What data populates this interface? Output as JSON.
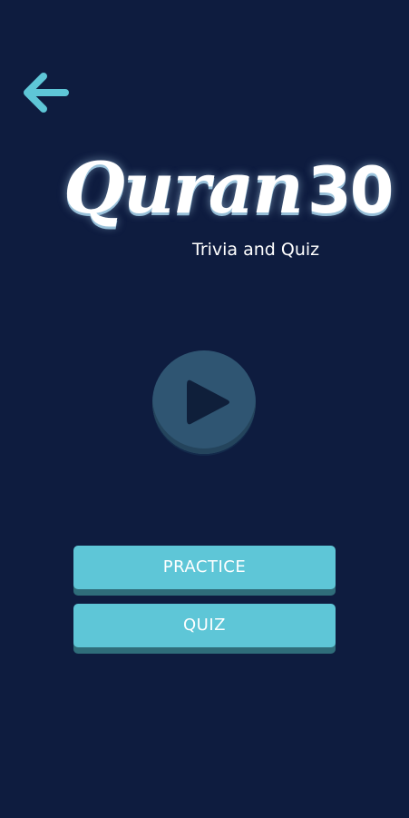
{
  "header": {
    "back_icon": "arrow-left-icon"
  },
  "logo": {
    "title_word": "Quran",
    "title_number": "30",
    "subtitle": "Trivia and Quiz"
  },
  "play": {
    "icon": "play-icon"
  },
  "menu": {
    "practice_label": "PRACTICE",
    "quiz_label": "QUIZ"
  },
  "colors": {
    "background": "#0e1c3f",
    "accent": "#5ec6d7",
    "accent_shadow": "#2f6d7a",
    "play_button": "#2f5572",
    "play_icon": "#0f1f3a",
    "back_arrow": "#5ec6d7"
  }
}
